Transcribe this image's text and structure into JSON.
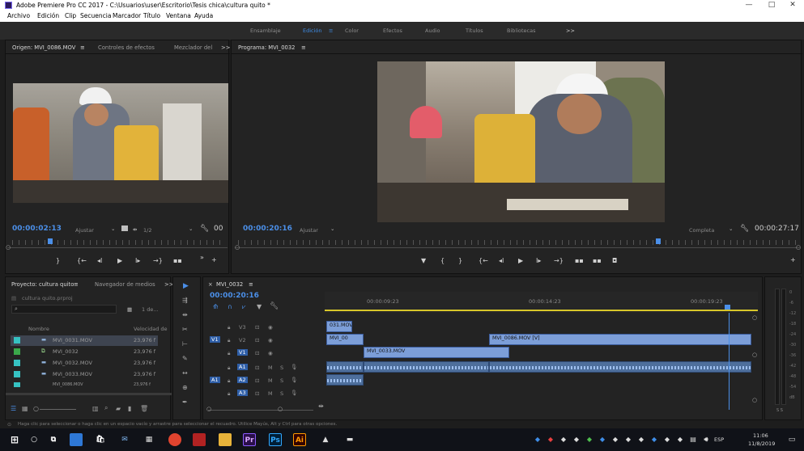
{
  "window": {
    "title": "Adobe Premiere Pro CC 2017 - C:\\Usuarios\\user\\Escritorio\\Tesis chica\\cultura quito *",
    "minimize": "—",
    "maximize": "□",
    "close": "✕"
  },
  "menu": [
    "Archivo",
    "Edición",
    "Clip",
    "Secuencia",
    "Marcador",
    "Título",
    "Ventana",
    "Ayuda"
  ],
  "workspaces": {
    "items": [
      "Ensamblaje",
      "Edición",
      "Color",
      "Efectos",
      "Audio",
      "Títulos",
      "Bibliotecas"
    ],
    "active": "Edición",
    "more": ">>"
  },
  "source": {
    "tabs": [
      "Origen: MVI_0086.MOV",
      "Controles de efectos",
      "Mezclador del"
    ],
    "more": ">>",
    "timecode": "00:00:02:13",
    "fit": "Ajustar",
    "resolution": "1/2",
    "duration_partial": "00"
  },
  "program": {
    "tab": "Programa: MVI_0032",
    "timecode": "00:00:20:16",
    "fit": "Ajustar",
    "quality": "Completa",
    "duration": "00:00:27:17"
  },
  "project": {
    "tabs": [
      "Proyecto: cultura quito",
      "Navegador de medios"
    ],
    "more": ">>",
    "file": "cultura quito.prproj",
    "search_placeholder": "",
    "count": "1 de...",
    "columns": [
      "Nombre",
      "Velocidad de"
    ],
    "items": [
      {
        "name": "MVI_0031.MOV",
        "fps": "23,976 f",
        "color": "#36c2c2",
        "selected": true
      },
      {
        "name": "MVI_0032",
        "fps": "23,976 f",
        "color": "#3aa84a",
        "selected": false
      },
      {
        "name": "MVI_0032.MOV",
        "fps": "23,976 f",
        "color": "#36c2c2",
        "selected": false
      },
      {
        "name": "MVI_0033.MOV",
        "fps": "23,976 f",
        "color": "#36c2c2",
        "selected": false
      },
      {
        "name": "MVI_0086.MOV",
        "fps": "23,976 f",
        "color": "#36c2c2",
        "selected": false
      }
    ]
  },
  "timeline": {
    "tab": "MVI_0032",
    "timecode": "00:00:20:16",
    "ruler": [
      "00:00:09:23",
      "00:00:14:23",
      "00:00:19:23"
    ],
    "video_tracks": [
      "V3",
      "V2",
      "V1"
    ],
    "audio_tracks": [
      "A1",
      "A2",
      "A3"
    ],
    "source_v": "V1",
    "source_a": "A1",
    "clips": {
      "v3_clip": "031.MOV",
      "v2_clip_a": "MVI_00",
      "v2_clip_b": "MVI_0086.MOV [V]",
      "v1_clip": "MVI_0033.MOV"
    }
  },
  "meters": {
    "scale": [
      "0",
      "-6",
      "-12",
      "-18",
      "-24",
      "-30",
      "-36",
      "-42",
      "-48",
      "-54",
      "dB"
    ],
    "solo": "S S"
  },
  "status": "Haga clic para seleccionar o haga clic en un espacio vacío y arrastre para seleccionar el recuadro. Utilice Mayús, Alt y Ctrl para otras opciones.",
  "taskbar": {
    "lang": "ESP",
    "time": "11:06",
    "date": "11/8/2019"
  },
  "colors": {
    "accent": "#3f8ee8",
    "timecode_blue": "#4b8fe8",
    "clip_video": "#7c9ed8",
    "clip_audio": "#4e6f9c",
    "playhead": "#4b8fe8",
    "work_area": "#d8c62a"
  }
}
